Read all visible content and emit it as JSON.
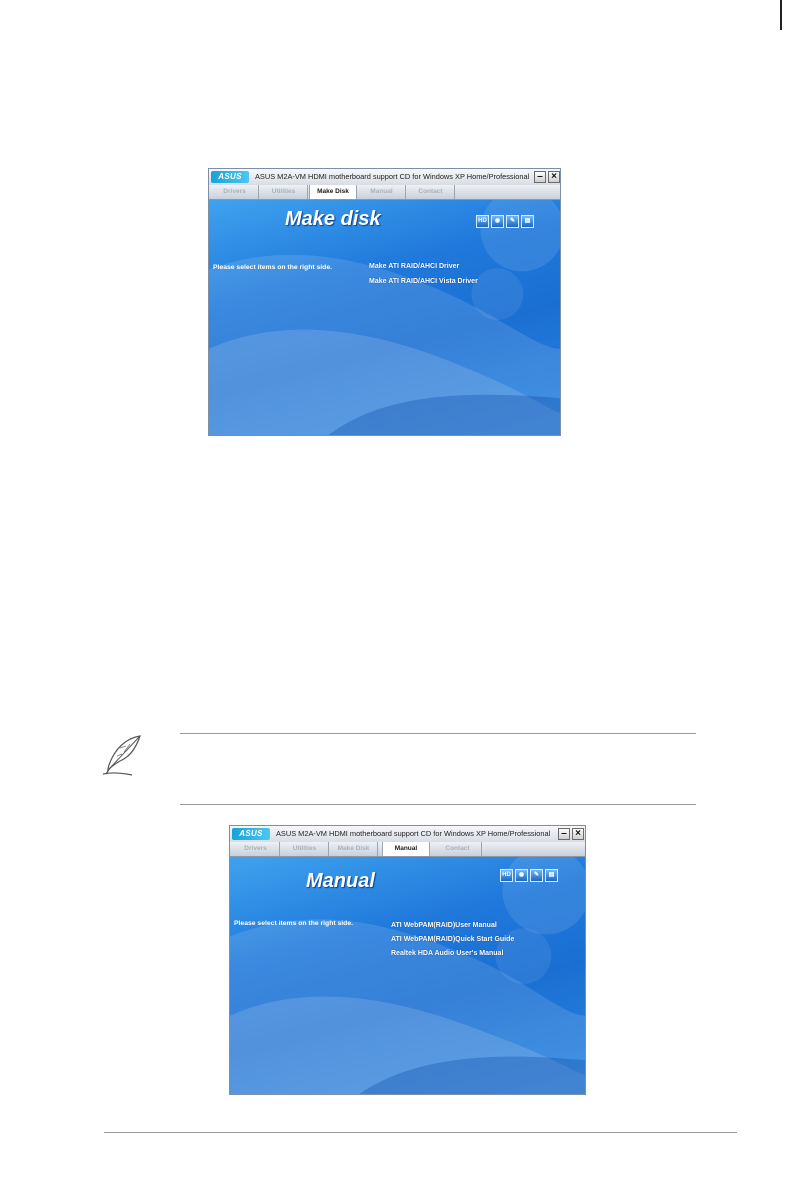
{
  "windows": [
    {
      "app_title": "ASUS M2A-VM HDMI motherboard support CD for Windows XP Home/Professional",
      "logo": "ASUS",
      "tabs": [
        "Drivers",
        "Utilities",
        "Make Disk",
        "Manual",
        "Contact"
      ],
      "active_tab": "Make Disk",
      "heading": "Make disk",
      "instruction": "Please select items on the right side.",
      "items": [
        "Make ATI RAID/AHCI Driver",
        "Make ATI RAID/AHCI Vista Driver"
      ],
      "tool_icons": [
        "HD",
        "cd-icon",
        "wrench-icon",
        "file-icon"
      ]
    },
    {
      "app_title": "ASUS M2A-VM HDMI motherboard support CD for Windows XP Home/Professional",
      "logo": "ASUS",
      "tabs": [
        "Drivers",
        "Utilities",
        "Make Disk",
        "Manual",
        "Contact"
      ],
      "active_tab": "Manual",
      "heading": "Manual",
      "instruction": "Please select items on the right side.",
      "items": [
        "ATI WebPAM(RAID)User Manual",
        "ATI WebPAM(RAID)Quick Start Guide",
        "Realtek HDA Audio User's Manual"
      ],
      "tool_icons": [
        "HD",
        "cd-icon",
        "wrench-icon",
        "file-icon"
      ]
    }
  ],
  "colors": {
    "window_bg": "#1f6fd0",
    "text": "#ffffff",
    "inactive_tab": "#a8b0bb"
  }
}
